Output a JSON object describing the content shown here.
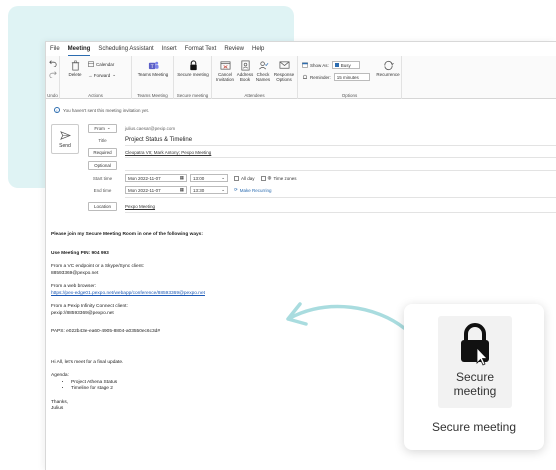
{
  "menu": {
    "tabs": [
      "File",
      "Meeting",
      "Scheduling Assistant",
      "Insert",
      "Format Text",
      "Review",
      "Help"
    ],
    "active": "Meeting"
  },
  "ribbon": {
    "undo_label": "Undo",
    "actions": {
      "delete": "Delete",
      "calendar": "Calendar",
      "forward": "→ Forward",
      "label": "Actions"
    },
    "teams": {
      "button": "Teams Meeting",
      "label": "Teams Meeting"
    },
    "secure": {
      "button": "Secure meeting",
      "label": "Secure meeting"
    },
    "attendees": {
      "cancel": "Cancel Invitation",
      "address": "Address Book",
      "check": "Check Names",
      "response": "Response Options",
      "label": "Attendees"
    },
    "options": {
      "show_as": "Show As:",
      "show_as_value": "Busy",
      "reminder": "Reminder:",
      "reminder_value": "15 minutes",
      "recurrence": "Recurrence",
      "label": "Options"
    }
  },
  "info": "You haven't sent this meeting invitation yet.",
  "form": {
    "send": "Send",
    "from_label": "From",
    "from_value": "julius.caesar@pexip.com",
    "title_label": "Title",
    "title_value": "Project Status & Timeline",
    "required_label": "Required",
    "required_value": "Cleopatra VII; Mark Antony; Pexpo Meeting",
    "optional_label": "Optional",
    "start_label": "Start time",
    "start_date": "Mon 2022-11-07",
    "start_time": "13:00",
    "all_day": "All day",
    "time_zones": "Time zones",
    "end_label": "End time",
    "end_date": "Mon 2022-11-07",
    "end_time": "13:30",
    "make_recurring": "Make Recurring",
    "location_label": "Location",
    "location_value": "Pexpo Meeting"
  },
  "body": {
    "intro": "Please join my Secure Meeting Room in one of the following ways:",
    "pin": "Use Meeting PIN: 904 993",
    "vc_label": "From a VC endpoint or a Skype/Sync client:",
    "vc_value": "88593369@pexpo.net",
    "web_label": "From a web browser:",
    "web_link": "https://pex-edge01.pexpo.net/webapp/conference/88593369@pexpo.net",
    "pic_label": "From a Pexip Infinity Connect client:",
    "pic_value": "pexip://88593369@pexpo.net",
    "paps": "PAPS: e022b43e-ea60-4905-8804-a03550ec6c3d#",
    "greeting": "Hi All, let's meet for a final update.",
    "agenda": "Agenda:",
    "items": [
      "Project Athena Status",
      "Timeline for stage 2"
    ],
    "thanks": "Thanks,",
    "signature": "Julius"
  },
  "card": {
    "button_line1": "Secure",
    "button_line2": "meeting",
    "title": "Secure meeting"
  },
  "colors": {
    "accent": "#2b6cb0",
    "teal_bg": "#dff3f4",
    "arrow": "#a9dcdf",
    "link": "#1a58b5"
  }
}
